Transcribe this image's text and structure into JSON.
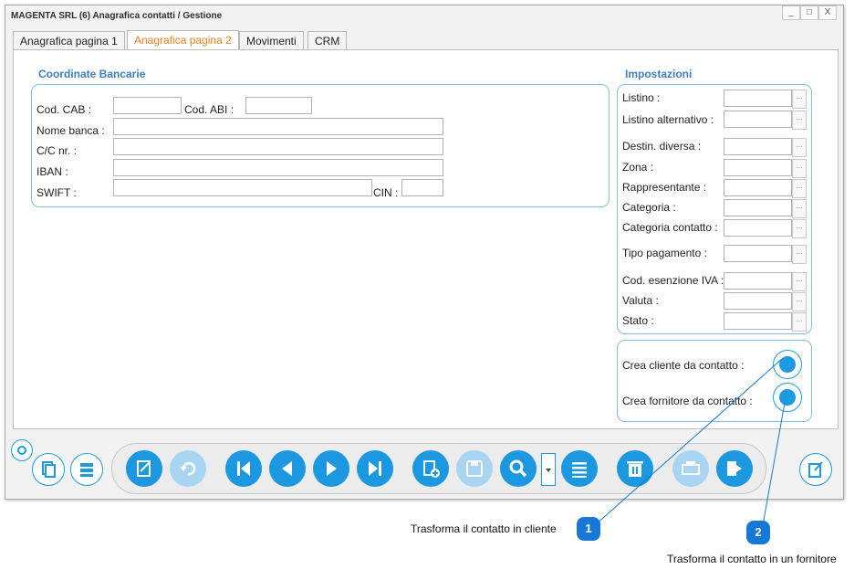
{
  "window": {
    "title": "MAGENTA SRL (6) Anagrafica contatti / Gestione",
    "controls": {
      "minimize": "_",
      "maximize": "□",
      "close": "X"
    }
  },
  "tabs": [
    {
      "label": "Anagrafica pagina 1"
    },
    {
      "label": "Anagrafica pagina 2"
    },
    {
      "label": "Movimenti"
    },
    {
      "label": "CRM"
    }
  ],
  "bank": {
    "title": "Coordinate Bancarie",
    "cab_label": "Cod. CAB :",
    "abi_label": "Cod. ABI :",
    "nome_label": "Nome banca :",
    "cc_label": "C/C nr. :",
    "iban_label": "IBAN :",
    "swift_label": "SWIFT :",
    "cin_label": "CIN :"
  },
  "settings": {
    "title": "Impostazioni",
    "fields": [
      {
        "label": "Listino :"
      },
      {
        "label": "Listino alternativo :"
      },
      {
        "label": "Destin. diversa :"
      },
      {
        "label": "Zona :"
      },
      {
        "label": "Rappresentante :"
      },
      {
        "label": "Categoria :"
      },
      {
        "label": "Categoria contatto :"
      },
      {
        "label": "Tipo pagamento :"
      },
      {
        "label": "Cod. esenzione IVA :"
      },
      {
        "label": "Valuta :"
      },
      {
        "label": "Stato :"
      }
    ],
    "ellipsis": "···"
  },
  "convert": {
    "cliente_label": "Crea cliente da contatto :",
    "fornitore_label": "Crea fornitore da contatto :"
  },
  "callouts": [
    {
      "number": "1",
      "text": "Trasforma il contatto in cliente"
    },
    {
      "number": "2",
      "text": "Trasforma il contatto in un fornitore"
    }
  ],
  "colors": {
    "accent": "#1b98e0",
    "active_tab": "#e8821e",
    "group_title": "#3d7ec4",
    "badge": "#1778d8"
  }
}
